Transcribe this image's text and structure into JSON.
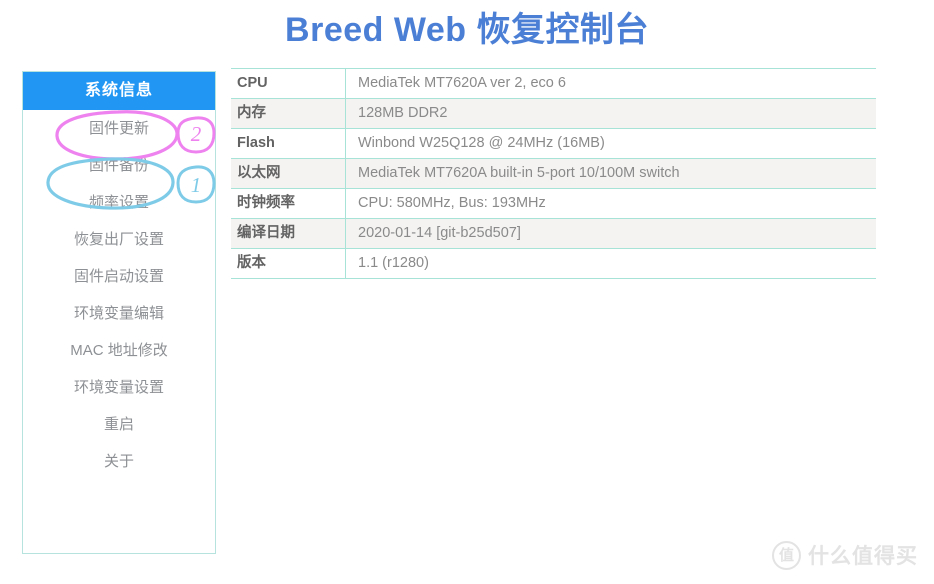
{
  "page": {
    "title": "Breed Web 恢复控制台",
    "title_color": "#4b7fd6",
    "background": "#ffffff"
  },
  "sidebar": {
    "header": "系统信息",
    "header_bg": "#2196f3",
    "border_color": "#b6e3de",
    "items": [
      {
        "label": "固件更新"
      },
      {
        "label": "固件备份"
      },
      {
        "label": "频率设置"
      },
      {
        "label": "恢复出厂设置"
      },
      {
        "label": "固件启动设置"
      },
      {
        "label": "环境变量编辑"
      },
      {
        "label": "MAC 地址修改"
      },
      {
        "label": "环境变量设置"
      },
      {
        "label": "重启"
      },
      {
        "label": "关于"
      }
    ]
  },
  "info_table": {
    "border_color": "#a8e3d8",
    "alt_row_bg": "#f4f3f2",
    "rows": [
      {
        "key": "CPU",
        "value": "MediaTek MT7620A ver 2, eco 6"
      },
      {
        "key": "内存",
        "value": "128MB DDR2"
      },
      {
        "key": "Flash",
        "value": "Winbond W25Q128 @ 24MHz (16MB)"
      },
      {
        "key": "以太网",
        "value": "MediaTek MT7620A built-in 5-port 10/100M switch"
      },
      {
        "key": "时钟频率",
        "value": "CPU: 580MHz, Bus: 193MHz"
      },
      {
        "key": "编译日期",
        "value": "2020-01-14 [git-b25d507]"
      },
      {
        "key": "版本",
        "value": "1.1 (r1280)"
      }
    ]
  },
  "annotations": [
    {
      "id": "annotation-firmware-update",
      "shape": "ellipse",
      "color": "#ee82ee",
      "target": "固件更新",
      "number": "2"
    },
    {
      "id": "annotation-firmware-backup",
      "shape": "ellipse",
      "color": "#7ecbe8",
      "target": "固件备份",
      "number": "1"
    }
  ],
  "watermark": {
    "badge": "值",
    "text": "什么值得买",
    "color": "#e3e3e3"
  }
}
